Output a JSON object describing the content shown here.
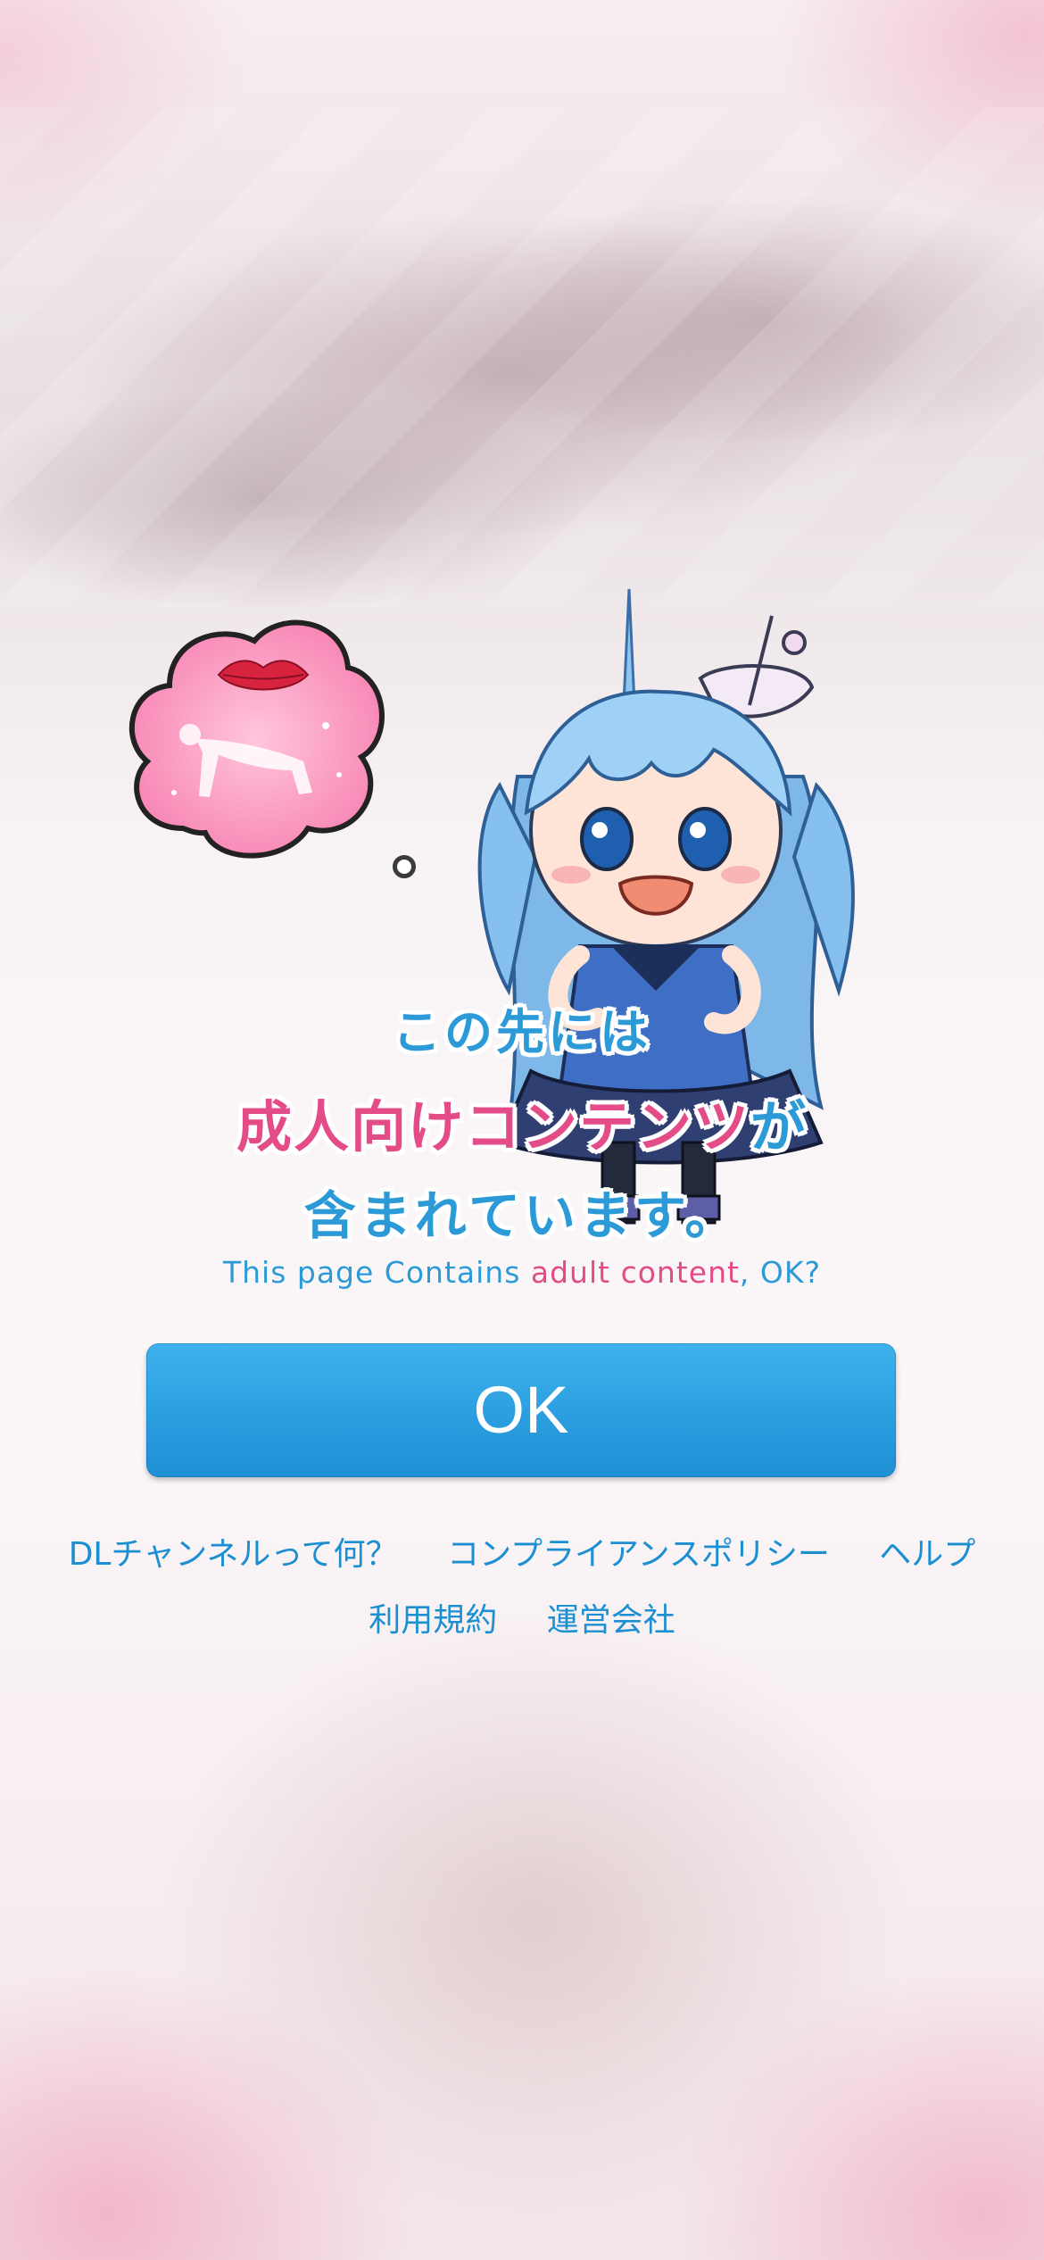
{
  "headline": {
    "line1": "この先には",
    "line2_pink": "成人向けコンテンツ",
    "line2_blue": "が",
    "line3": "含まれています。"
  },
  "subline": {
    "part1": "This page Contains ",
    "part2": "adult content",
    "part3": ", OK?"
  },
  "ok_button": {
    "label": "OK"
  },
  "footer_links": {
    "row1": [
      "DLチャンネルって何？",
      "コンプライアンスポリシー",
      "ヘルプ"
    ],
    "row2": [
      "利用規約",
      "運営会社"
    ]
  },
  "colors": {
    "accent_blue": "#2d9ad8",
    "accent_pink": "#e44c88",
    "button_blue": "#2b9ee0",
    "link_blue": "#1b8fd1"
  },
  "icons": {
    "thought_bubble": "thought-bubble-icon",
    "mascot": "mascot-character-illustration"
  }
}
